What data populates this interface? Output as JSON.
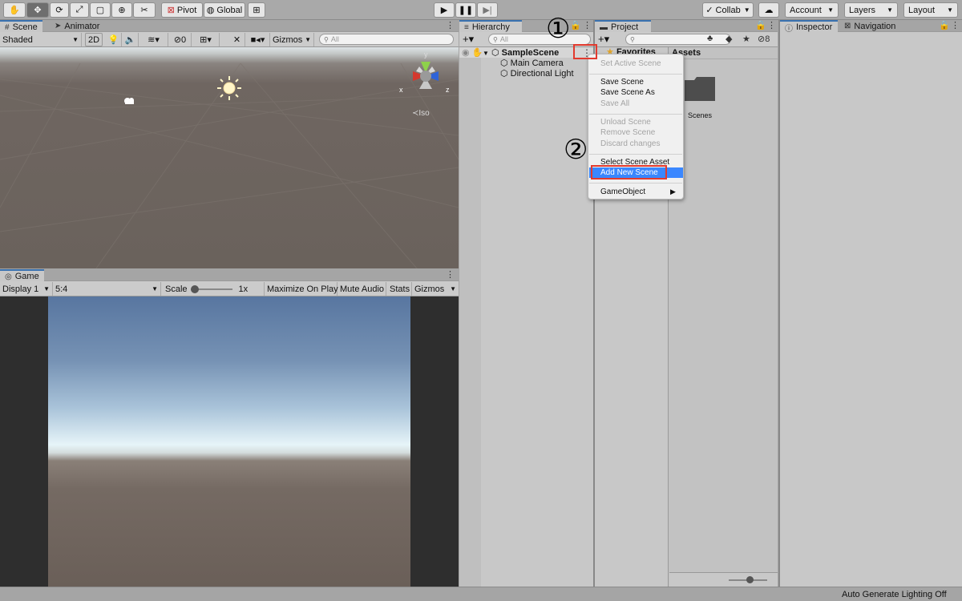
{
  "toolbar": {
    "tools": [
      "hand-tool",
      "move-tool",
      "rotate-tool",
      "scale-tool",
      "rect-tool",
      "transform-tool",
      "custom-tool"
    ],
    "pivot_label": "Pivot",
    "global_label": "Global",
    "collab_label": "Collab",
    "account_label": "Account",
    "layers_label": "Layers",
    "layout_label": "Layout"
  },
  "scene_panel": {
    "tabs": [
      "Scene",
      "Animator"
    ],
    "shading_mode": "Shaded",
    "two_d_label": "2D",
    "hidden_count": "0",
    "gizmos_label": "Gizmos",
    "search_placeholder": "All",
    "axis_x": "x",
    "axis_y": "y",
    "axis_z": "z",
    "projection_label": "Iso"
  },
  "game_panel": {
    "tab": "Game",
    "display": "Display 1",
    "aspect": "5:4",
    "scale_label": "Scale",
    "scale_value": "1x",
    "maximize_label": "Maximize On Play",
    "mute_label": "Mute Audio",
    "stats_label": "Stats",
    "gizmos_label": "Gizmos"
  },
  "hierarchy": {
    "tab": "Hierarchy",
    "search_placeholder": "All",
    "scene_name": "SampleScene",
    "objects": [
      "Main Camera",
      "Directional Light"
    ]
  },
  "context_menu": {
    "groups": [
      [
        {
          "label": "Set Active Scene",
          "enabled": false
        }
      ],
      [
        {
          "label": "Save Scene",
          "enabled": true
        },
        {
          "label": "Save Scene As",
          "enabled": true
        },
        {
          "label": "Save All",
          "enabled": false
        }
      ],
      [
        {
          "label": "Unload Scene",
          "enabled": false
        },
        {
          "label": "Remove Scene",
          "enabled": false
        },
        {
          "label": "Discard changes",
          "enabled": false
        }
      ],
      [
        {
          "label": "Select Scene Asset",
          "enabled": true
        },
        {
          "label": "Add New Scene",
          "enabled": true,
          "highlighted": true
        }
      ],
      [
        {
          "label": "GameObject",
          "enabled": true,
          "submenu": true
        }
      ]
    ]
  },
  "annotations": {
    "step1": "①",
    "step2": "②"
  },
  "project": {
    "tab": "Project",
    "favorites_label": "Favorites",
    "assets_label": "Assets",
    "hidden_count": "8",
    "folders": [
      "Scenes"
    ]
  },
  "inspector": {
    "tabs": [
      "Inspector",
      "Navigation"
    ]
  },
  "status": {
    "message": "Auto Generate Lighting Off"
  },
  "colors": {
    "accent": "#3a87ff",
    "annotation_red": "#e23a2e",
    "tab_highlight": "#3a72b0"
  }
}
